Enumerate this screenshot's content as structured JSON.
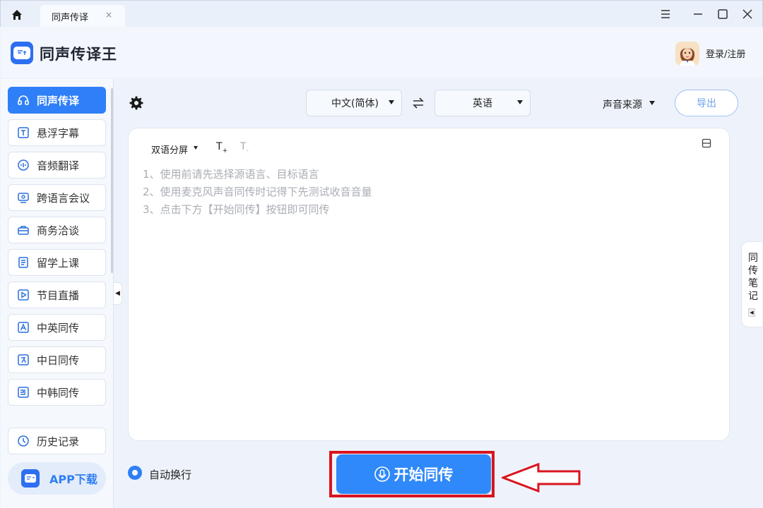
{
  "tab": {
    "title": "同声传译",
    "close": "×"
  },
  "header": {
    "app_title": "同声传译王",
    "login": "登录/注册"
  },
  "sidebar": {
    "items": [
      {
        "label": "同声传译",
        "icon": "headset-icon",
        "active": true
      },
      {
        "label": "悬浮字幕",
        "icon": "text-box-icon"
      },
      {
        "label": "音频翻译",
        "icon": "audio-wave-icon"
      },
      {
        "label": "跨语言会议",
        "icon": "meeting-icon"
      },
      {
        "label": "商务洽谈",
        "icon": "briefcase-icon"
      },
      {
        "label": "留学上课",
        "icon": "book-icon"
      },
      {
        "label": "节目直播",
        "icon": "play-icon"
      },
      {
        "label": "中英同传",
        "icon": "letter-a-icon"
      },
      {
        "label": "中日同传",
        "icon": "japanese-icon"
      },
      {
        "label": "中韩同传",
        "icon": "korean-icon"
      }
    ],
    "history": "历史记录",
    "app_download": "APP下载"
  },
  "toolbar": {
    "source_lang": "中文(简体)",
    "target_lang": "英语",
    "sound_source": "声音来源",
    "export": "导出"
  },
  "panel": {
    "split_mode": "双语分屏",
    "hints": [
      "1、使用前请先选择源语言、目标语言",
      "2、使用麦克风声音同传时记得下先测试收音音量",
      "3、点击下方【开始同传】按钮即可同传"
    ]
  },
  "notes_tab": "同传笔记",
  "bottom": {
    "auto_wrap": "自动换行",
    "start": "开始同传"
  },
  "colors": {
    "primary": "#2f80f8",
    "highlight": "#d9141f",
    "hint": "#a9adb4"
  }
}
